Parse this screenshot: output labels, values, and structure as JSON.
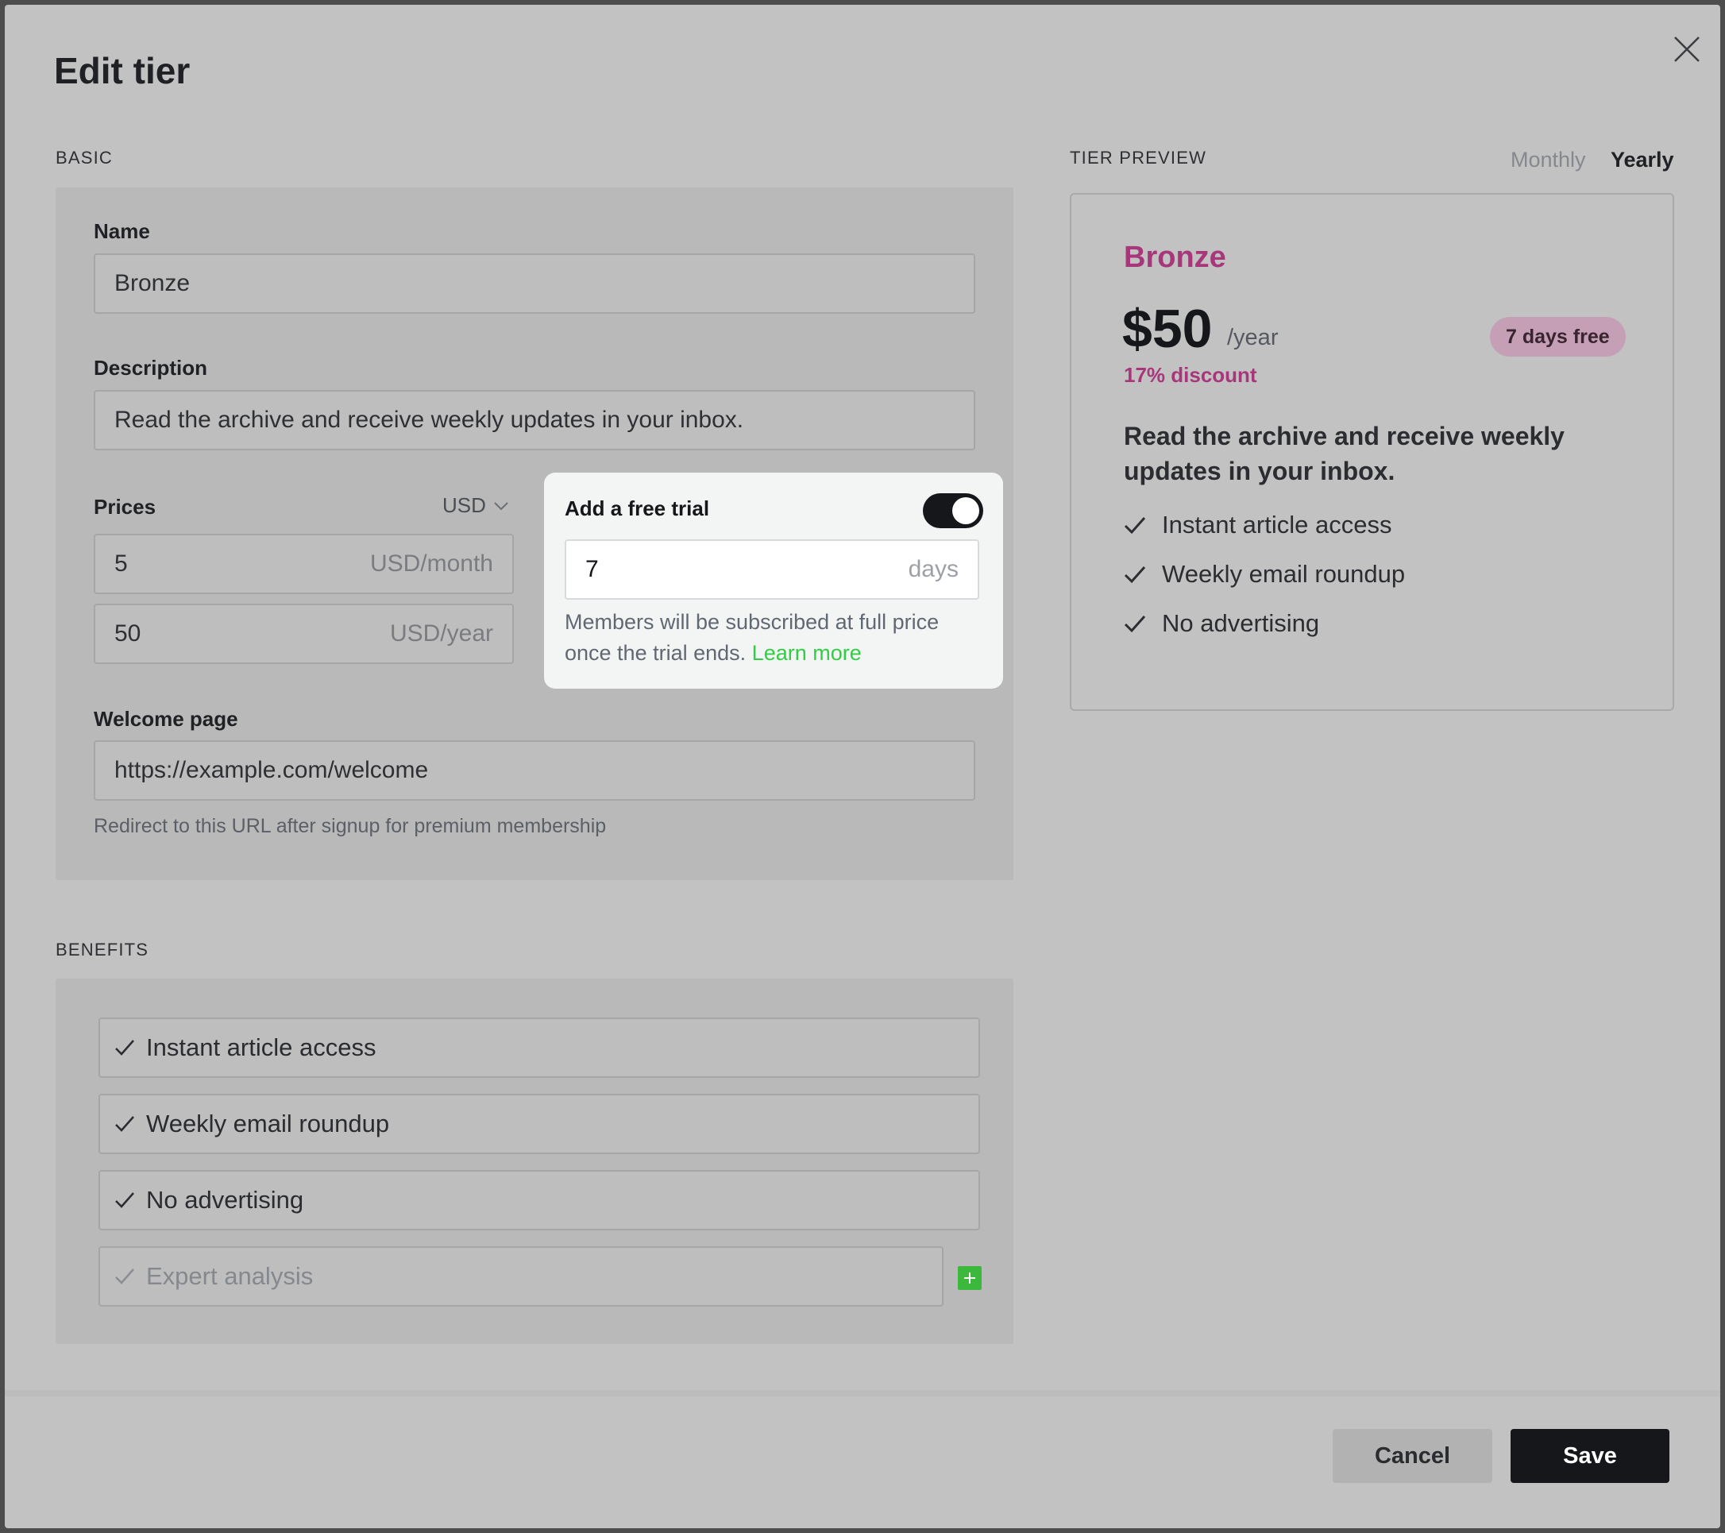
{
  "modal": {
    "title": "Edit tier"
  },
  "basic": {
    "section_label": "BASIC",
    "name_label": "Name",
    "name_value": "Bronze",
    "description_label": "Description",
    "description_value": "Read the archive and receive weekly updates in your inbox.",
    "prices_label": "Prices",
    "currency": "USD",
    "monthly_value": "5",
    "monthly_suffix": "USD/month",
    "yearly_value": "50",
    "yearly_suffix": "USD/year",
    "welcome_label": "Welcome page",
    "welcome_value": "https://example.com/welcome",
    "welcome_hint": "Redirect to this URL after signup for premium membership"
  },
  "free_trial": {
    "label": "Add a free trial",
    "enabled": true,
    "days_value": "7",
    "days_suffix": "days",
    "note": "Members will be subscribed at full price once the trial ends.",
    "learn_more": "Learn more"
  },
  "preview": {
    "section_label": "TIER PREVIEW",
    "tabs": [
      {
        "label": "Monthly",
        "active": false
      },
      {
        "label": "Yearly",
        "active": true
      }
    ],
    "name": "Bronze",
    "price": "$50",
    "period": "/year",
    "badge": "7 days free",
    "discount": "17% discount",
    "description": "Read the archive and receive weekly updates in your inbox.",
    "benefits": [
      "Instant article access",
      "Weekly email roundup",
      "No advertising"
    ]
  },
  "benefits": {
    "section_label": "BENEFITS",
    "items": [
      "Instant article access",
      "Weekly email roundup",
      "No advertising"
    ],
    "new_placeholder": "Expert analysis"
  },
  "footer": {
    "cancel_label": "Cancel",
    "save_label": "Save"
  },
  "colors": {
    "accent": "#a8367b",
    "link_green": "#30cf43",
    "primary_button": "#15171a",
    "add_button": "#3cb93c"
  },
  "icons": {
    "close": "close-icon",
    "check": "check-icon",
    "chevron": "chevron-down-icon",
    "add": "plus-icon"
  }
}
